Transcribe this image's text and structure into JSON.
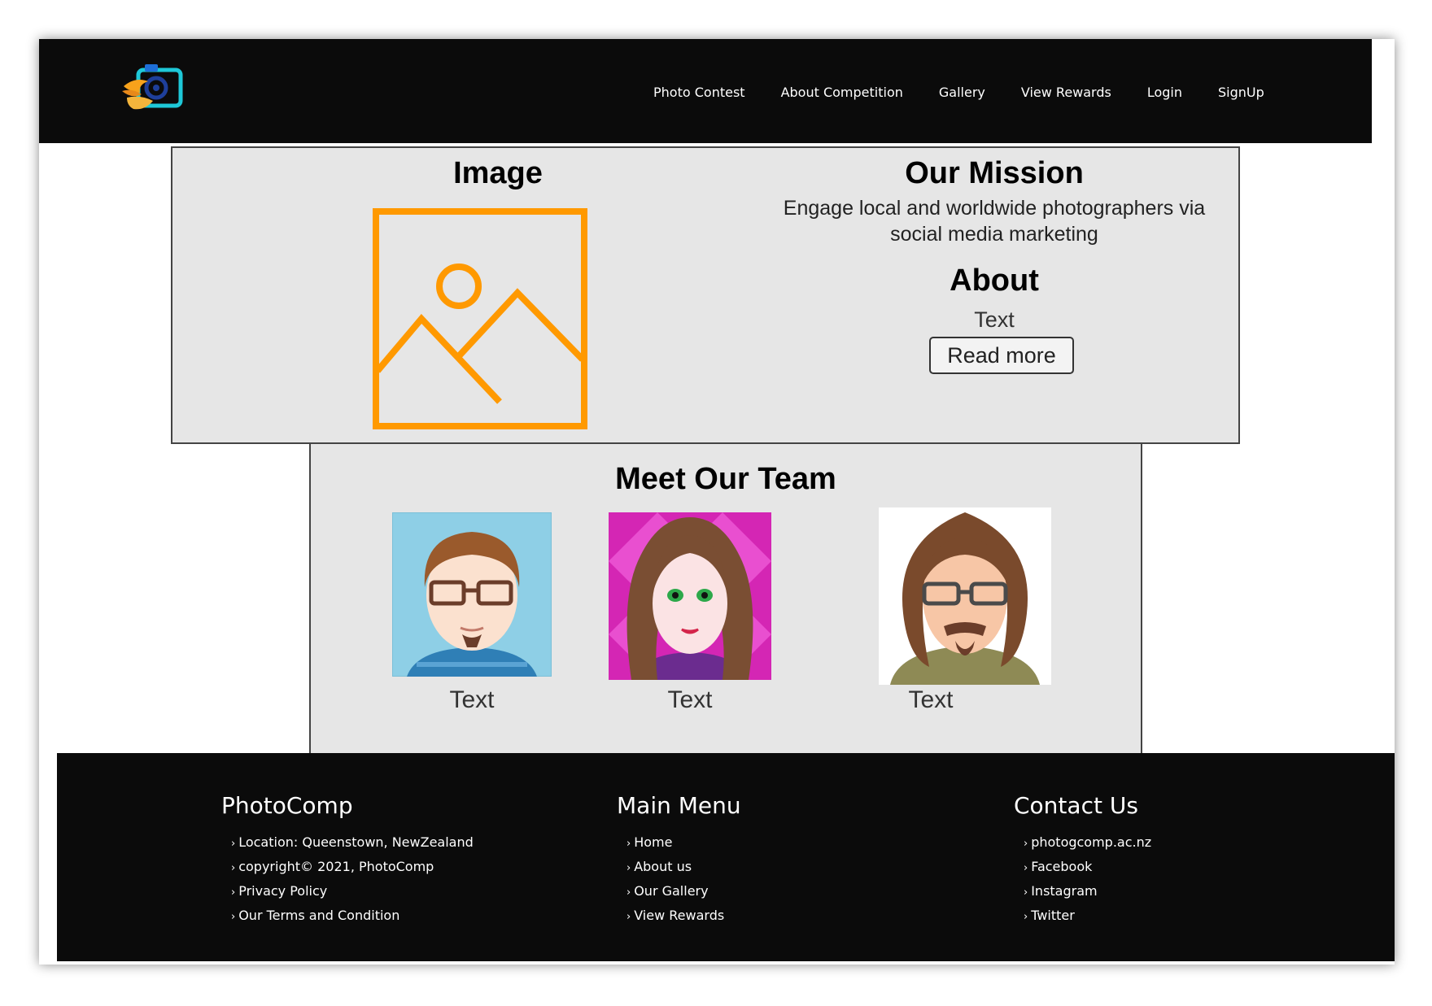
{
  "navbar": {
    "links": [
      "Photo Contest",
      "About Competition",
      "Gallery",
      "View Rewards",
      "Login",
      "SignUp"
    ]
  },
  "top_panel": {
    "image_heading": "Image",
    "mission_heading": "Our Mission",
    "mission_text": "Engage local and worldwide photographers via social media marketing",
    "about_heading": "About",
    "about_text": "Text",
    "read_more_label": "Read more"
  },
  "team": {
    "heading": "Meet Our Team",
    "members": [
      {
        "name": "Text"
      },
      {
        "name": "Text"
      },
      {
        "name": "Text"
      }
    ]
  },
  "footer": {
    "columns": [
      {
        "title": "PhotoComp",
        "links": [
          "Location: Queenstown, NewZealand",
          "copyright© 2021, PhotoComp",
          "Privacy Policy",
          "Our Terms and Condition"
        ]
      },
      {
        "title": "Main Menu",
        "links": [
          "Home",
          "About us",
          "Our Gallery",
          "View Rewards"
        ]
      },
      {
        "title": "Contact Us",
        "links": [
          "photogcomp.ac.nz",
          "Facebook",
          "Instagram",
          "Twitter"
        ]
      }
    ]
  },
  "colors": {
    "nav_bg": "#0b0b0b",
    "panel_bg": "#e6e6e6",
    "image_icon": "#ff9900",
    "logo_orange": "#f7a21b",
    "logo_teal": "#1ec8d8"
  }
}
